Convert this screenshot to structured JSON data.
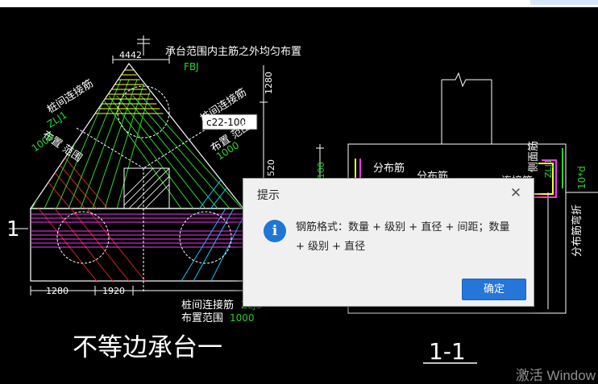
{
  "canvas": {
    "left_section_title": "不等边承台一",
    "right_section_title": "1-1",
    "section_marker": "1",
    "annotations": {
      "top_note": "承台范围内主筋之外均匀布置",
      "fbj": "FBJ",
      "dim_4442": "4442",
      "dim_1280_v": "1280",
      "dim_520": "520",
      "dim_100_v": "100",
      "left_conn_title": "桩间连接筋",
      "left_conn_tag": "ZLJ1",
      "left_range": "布置 范围",
      "left_range_value": "1000",
      "right_conn_title": "桩间连接筋",
      "right_range": "布置 范围",
      "right_range_value": "1000",
      "tooltip": "c22-100",
      "bottom_conn_title": "桩间连接筋",
      "bottom_conn_tag": "ZLJ3",
      "bottom_range": "布置范围",
      "bottom_range_value": "1000",
      "dim_1280_h": "1280",
      "dim_1920": "1920",
      "dist_bar_1": "分布筋",
      "dist_bar_2": "分布筋",
      "side_face_bar": "侧面筋",
      "conn_bar_short": "连接筋",
      "zlj_tag": "ZLJ1",
      "count_label": "10*d",
      "bent_bar": "分布筋弯折"
    }
  },
  "dialog": {
    "title": "提示",
    "icon": "info-icon",
    "message": "钢筋格式：数量 + 级别 + 直径 + 间距；数量 + 级别 + 直径",
    "ok_label": "确定"
  },
  "watermark": "激活 Window",
  "colors": {
    "background": "#000000",
    "white": "#ffffff",
    "green": "#29d629",
    "cyan": "#00ccff",
    "magenta": "#ff33ff",
    "red": "#e02020",
    "yellow": "#ffff33",
    "accent_button": "#2576d8"
  }
}
